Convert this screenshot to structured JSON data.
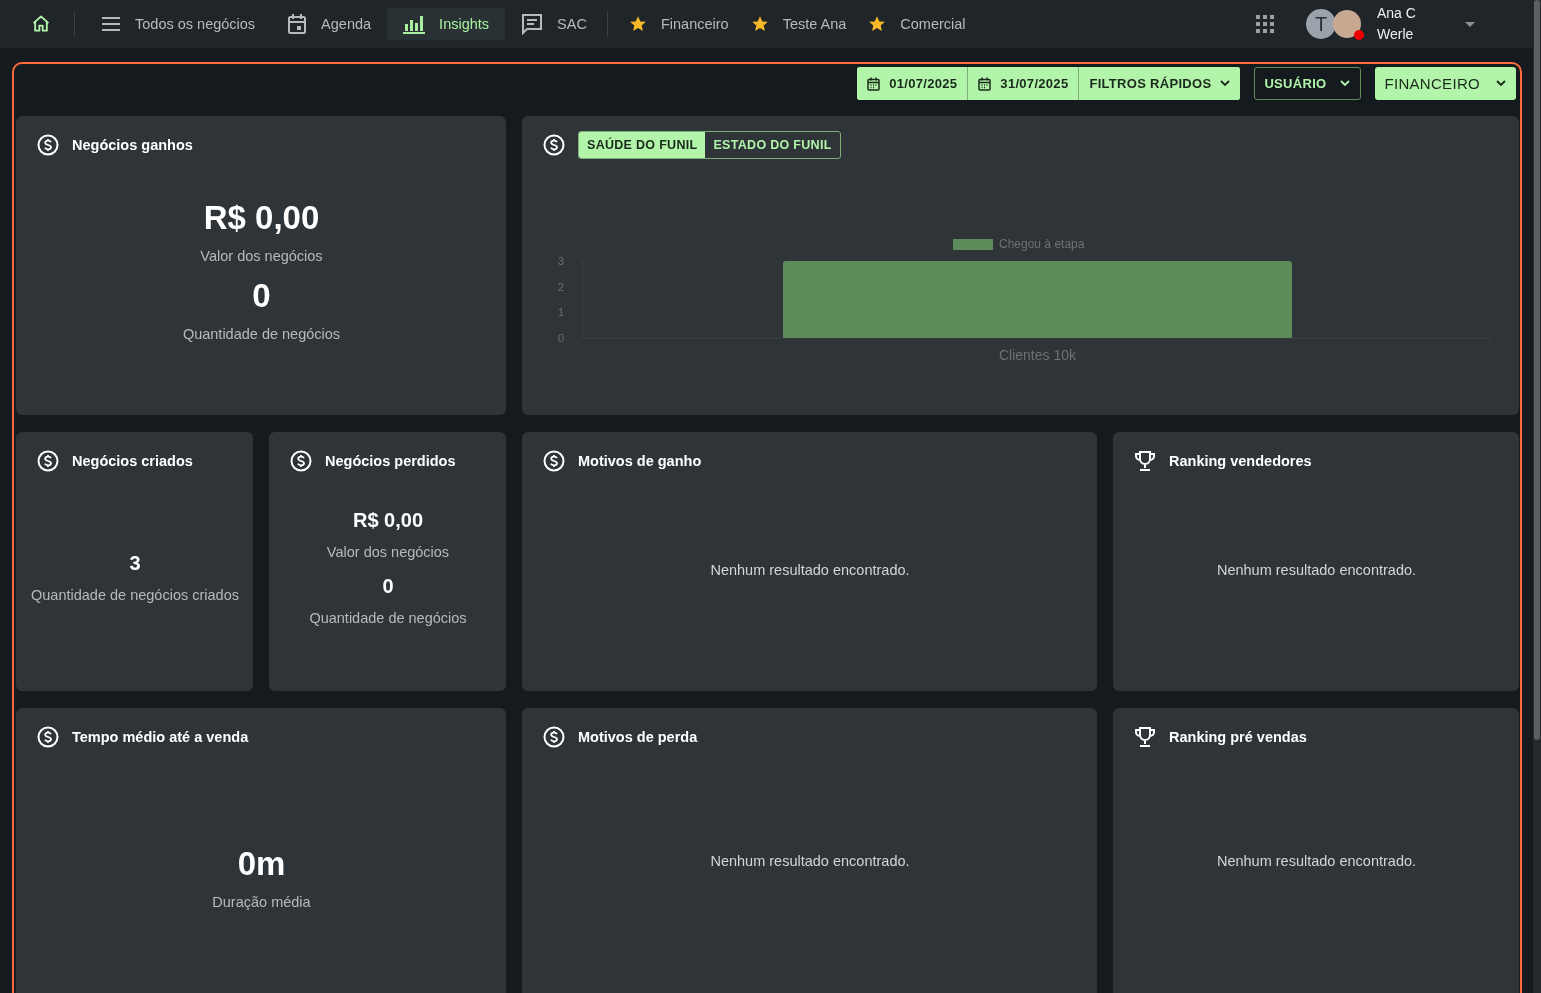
{
  "nav": {
    "home": {
      "selected": false
    },
    "items": [
      {
        "label": "Todos os negócios",
        "selected": false
      },
      {
        "label": "Agenda",
        "selected": false
      },
      {
        "label": "Insights",
        "selected": true
      },
      {
        "label": "SAC",
        "selected": false
      }
    ],
    "favorites": [
      {
        "label": "Financeiro"
      },
      {
        "label": "Teste Ana"
      },
      {
        "label": "Comercial"
      }
    ],
    "user": {
      "initial": "T",
      "name": "Ana C Werle"
    }
  },
  "filters": [
    {
      "kind": "date",
      "label": "01/07/2025"
    },
    {
      "kind": "date",
      "label": "31/07/2025"
    },
    {
      "kind": "dropdown",
      "label": "FILTROS RÁPIDOS"
    },
    {
      "kind": "outline",
      "label": "USUÁRIO"
    },
    {
      "kind": "primary",
      "label": "FINANCEIRO"
    }
  ],
  "cards": [
    {
      "kind": "stats",
      "title": "Negócios ganhos",
      "stats": [
        {
          "value": "R$ 0,00",
          "label": "Valor dos negócios"
        },
        {
          "value": "0",
          "label": "Quantidade de negócios"
        }
      ]
    },
    {
      "kind": "chart",
      "tabs": [
        {
          "label": "SAÚDE DO FUNIL",
          "selected": true
        },
        {
          "label": "ESTADO DO FUNIL",
          "selected": false
        }
      ],
      "chart_data": {
        "type": "bar",
        "categories": [
          "Clientes 10k"
        ],
        "series": [
          {
            "name": "Chegou à etapa",
            "color": "#5b8c5a",
            "values": [
              3
            ]
          }
        ],
        "ylim": [
          0,
          3
        ],
        "yticks": [
          0,
          1,
          2,
          3
        ]
      }
    },
    {
      "kind": "stats",
      "title": "Negócios criados",
      "stats": [
        {
          "value": "3",
          "label": "Quantidade de negócios criados"
        }
      ]
    },
    {
      "kind": "stats",
      "title": "Negócios perdidos",
      "stats": [
        {
          "value": "R$ 0,00",
          "label": "Valor dos negócios"
        },
        {
          "value": "0",
          "label": "Quantidade de negócios"
        }
      ]
    },
    {
      "kind": "empty",
      "title": "Motivos de ganho",
      "message": "Nenhum resultado encontrado."
    },
    {
      "kind": "empty",
      "title": "Ranking vendedores",
      "message": "Nenhum resultado encontrado."
    },
    {
      "kind": "stats",
      "title": "Tempo médio até a venda",
      "stats": [
        {
          "value": "0m",
          "label": "Duração média"
        }
      ]
    },
    {
      "kind": "empty",
      "title": "Motivos de perda",
      "message": "Nenhum resultado encontrado."
    },
    {
      "kind": "empty",
      "title": "Ranking pré vendas",
      "message": "Nenhum resultado encontrado."
    }
  ]
}
